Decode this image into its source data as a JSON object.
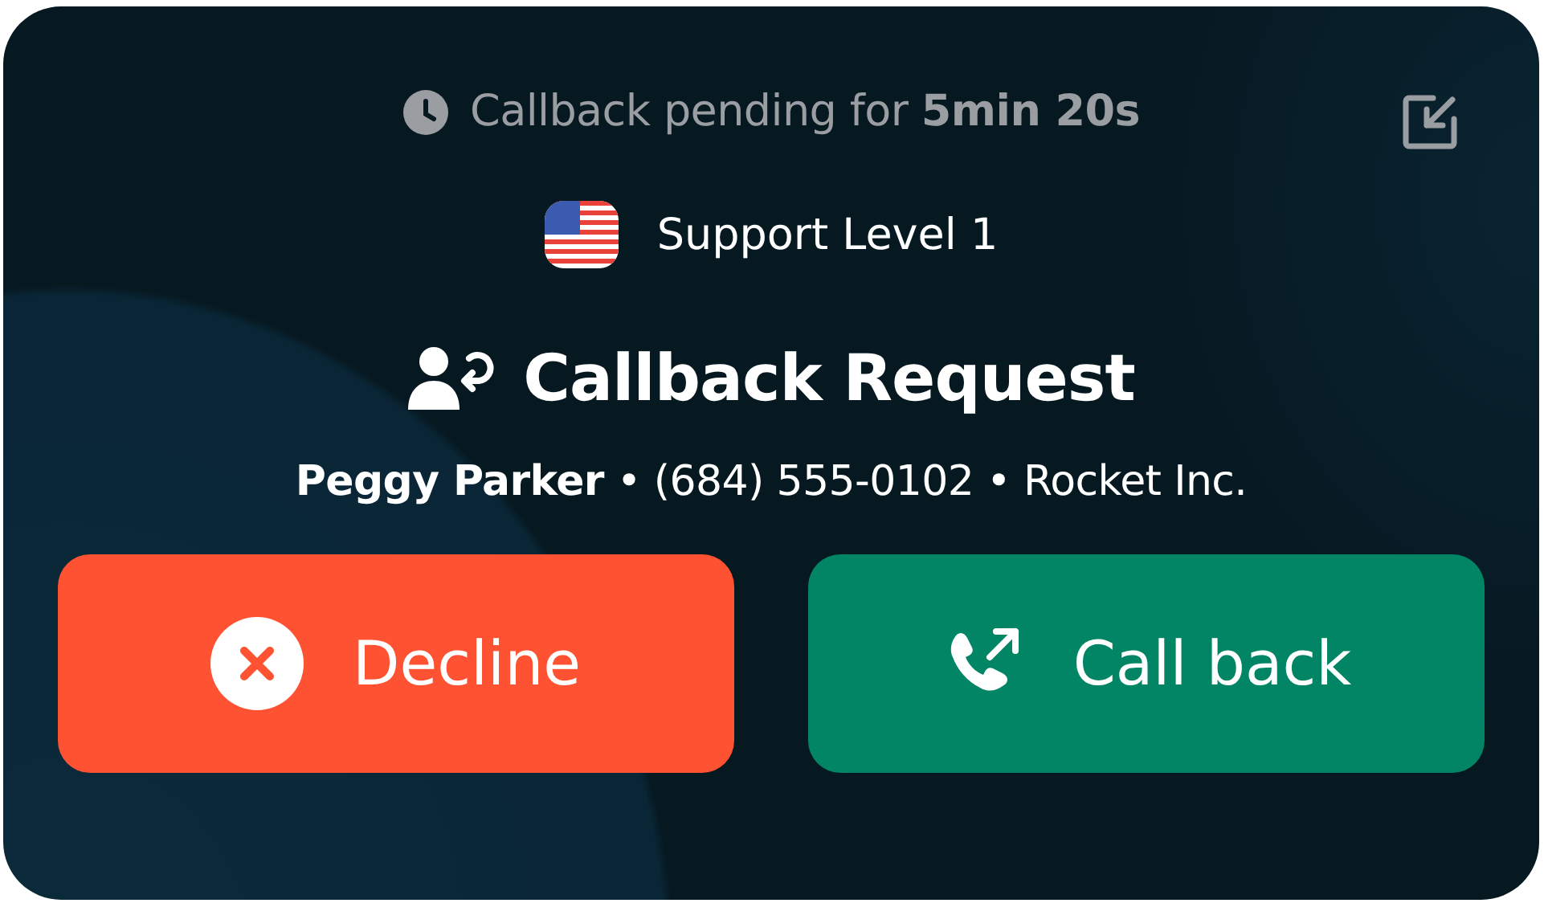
{
  "status": {
    "text": "Callback pending for **5min 20s**"
  },
  "queue": {
    "label": "Support Level 1"
  },
  "title": "Callback Request",
  "caller": "**Peggy Parker** • (684) 555-0102 • Rocket Inc.",
  "buttons": [
    {
      "kind": "decline",
      "label": "Decline"
    },
    {
      "kind": "callback",
      "label": "Call back"
    }
  ]
}
